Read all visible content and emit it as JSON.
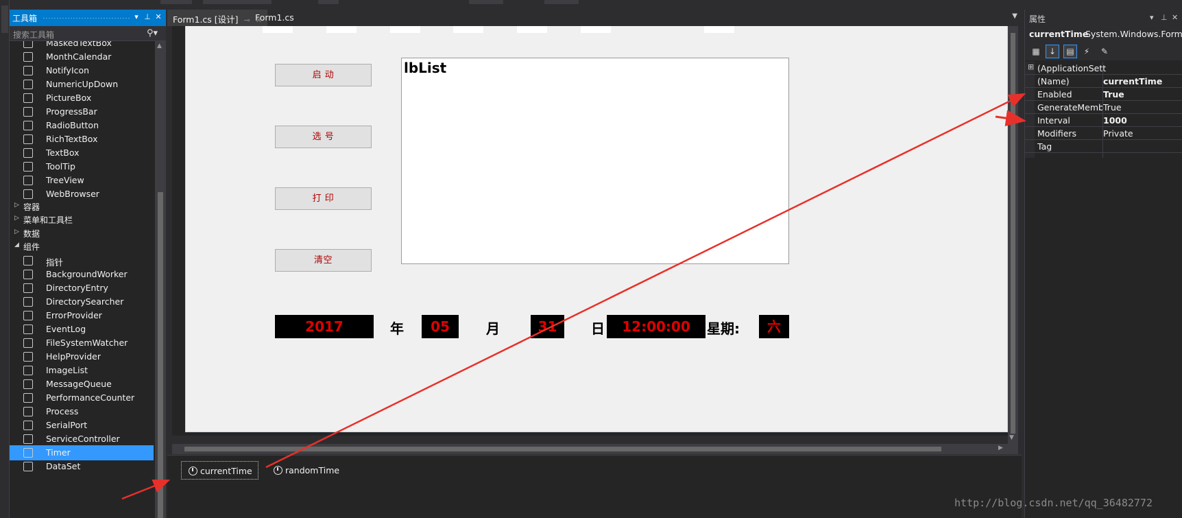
{
  "toolbox": {
    "title": "工具箱",
    "search_placeholder": "搜索工具箱",
    "partial_top_item": "MaskedTextBox",
    "items": [
      {
        "label": "MonthCalendar",
        "icon": "month-calendar-icon"
      },
      {
        "label": "NotifyIcon",
        "icon": "notify-icon-icon"
      },
      {
        "label": "NumericUpDown",
        "icon": "numeric-updown-icon"
      },
      {
        "label": "PictureBox",
        "icon": "picture-box-icon"
      },
      {
        "label": "ProgressBar",
        "icon": "progress-bar-icon"
      },
      {
        "label": "RadioButton",
        "icon": "radio-button-icon"
      },
      {
        "label": "RichTextBox",
        "icon": "rich-textbox-icon"
      },
      {
        "label": "TextBox",
        "icon": "textbox-icon"
      },
      {
        "label": "ToolTip",
        "icon": "tooltip-icon"
      },
      {
        "label": "TreeView",
        "icon": "treeview-icon"
      },
      {
        "label": "WebBrowser",
        "icon": "web-browser-icon"
      }
    ],
    "categories": [
      {
        "label": "容器",
        "expanded": false
      },
      {
        "label": "菜单和工具栏",
        "expanded": false
      },
      {
        "label": "数据",
        "expanded": false
      },
      {
        "label": "组件",
        "expanded": true
      }
    ],
    "component_items": [
      {
        "label": "指针",
        "icon": "pointer-icon"
      },
      {
        "label": "BackgroundWorker",
        "icon": "background-worker-icon"
      },
      {
        "label": "DirectoryEntry",
        "icon": "directory-entry-icon"
      },
      {
        "label": "DirectorySearcher",
        "icon": "directory-searcher-icon"
      },
      {
        "label": "ErrorProvider",
        "icon": "error-provider-icon"
      },
      {
        "label": "EventLog",
        "icon": "event-log-icon"
      },
      {
        "label": "FileSystemWatcher",
        "icon": "filesystem-watcher-icon"
      },
      {
        "label": "HelpProvider",
        "icon": "help-provider-icon"
      },
      {
        "label": "ImageList",
        "icon": "image-list-icon"
      },
      {
        "label": "MessageQueue",
        "icon": "message-queue-icon"
      },
      {
        "label": "PerformanceCounter",
        "icon": "performance-counter-icon"
      },
      {
        "label": "Process",
        "icon": "process-icon"
      },
      {
        "label": "SerialPort",
        "icon": "serial-port-icon"
      },
      {
        "label": "ServiceController",
        "icon": "service-controller-icon"
      },
      {
        "label": "Timer",
        "icon": "timer-icon",
        "selected": true
      },
      {
        "label": "DataSet",
        "icon": "dataset-icon"
      }
    ]
  },
  "doc_tabs": [
    {
      "label": "Form1.cs [设计]",
      "active": true
    },
    {
      "label": "Form1.cs",
      "active": false
    }
  ],
  "form": {
    "buttons": [
      "启  动",
      "选  号",
      "打  印",
      "清空"
    ],
    "list_caption": "lbList",
    "date": {
      "year": "2017",
      "year_unit": "年",
      "month": "05",
      "month_unit": "月",
      "day": "31",
      "day_unit": "日",
      "time": "12:00:00",
      "weekday_label": "星期:",
      "weekday": "六"
    }
  },
  "tray": {
    "components": [
      {
        "label": "currentTime",
        "selected": true
      },
      {
        "label": "randomTime",
        "selected": false
      }
    ]
  },
  "properties": {
    "title": "属性",
    "object_name": "currentTime",
    "object_type": "System.Windows.Form",
    "rows": [
      {
        "key": "(ApplicationSett",
        "value": "",
        "expandable": true
      },
      {
        "key": "(Name)",
        "value": "currentTime",
        "bold": true
      },
      {
        "key": "Enabled",
        "value": "True",
        "bold": true
      },
      {
        "key": "GenerateMemb",
        "value": "True",
        "bold": false
      },
      {
        "key": "Interval",
        "value": "1000",
        "bold": true
      },
      {
        "key": "Modifiers",
        "value": "Private",
        "bold": false
      },
      {
        "key": "Tag",
        "value": "",
        "bold": false
      }
    ]
  },
  "watermark": "http://blog.csdn.net/qq_36482772",
  "colors": {
    "accent": "#007acc",
    "selection": "#3399ff",
    "annotation_arrow": "#e8302a",
    "lcd_text": "#e00000"
  }
}
